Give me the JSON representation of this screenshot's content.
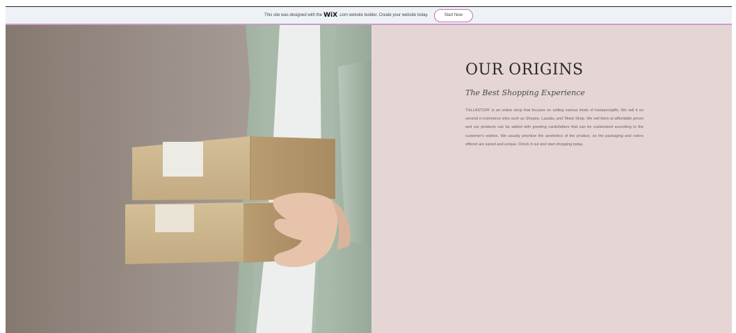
{
  "top_fragment": "”",
  "banner": {
    "text_before": "This site was designed with the",
    "brand": "WiX",
    "text_after": ".com website builder. Create your website today.",
    "cta_label": "Start Now"
  },
  "hero": {
    "image_alt": "Person holding two cardboard boxes"
  },
  "origins": {
    "title": "OUR ORIGINS",
    "subtitle": "The Best Shopping Experience",
    "body": "THLLASTUFF is an online shop that focuses on selling various kinds of hampers/gifts. We sell it on several e-commerce sites such as Shopee, Lazada, and Tiktok Shop. We sell them at affordable prices and our products can be added with greeting cards/letters that can be customized according to the customer's wishes. We usually prioritize the aesthetics of the product, so the packaging and colors offered are varied and unique. Check it out and start shopping today."
  },
  "colors": {
    "banner_bg": "#eef1f5",
    "banner_border": "#c99cc9",
    "cta_border": "#c76dbd",
    "panel_bg": "#e6d5d5",
    "title_color": "#2a2a2a"
  }
}
